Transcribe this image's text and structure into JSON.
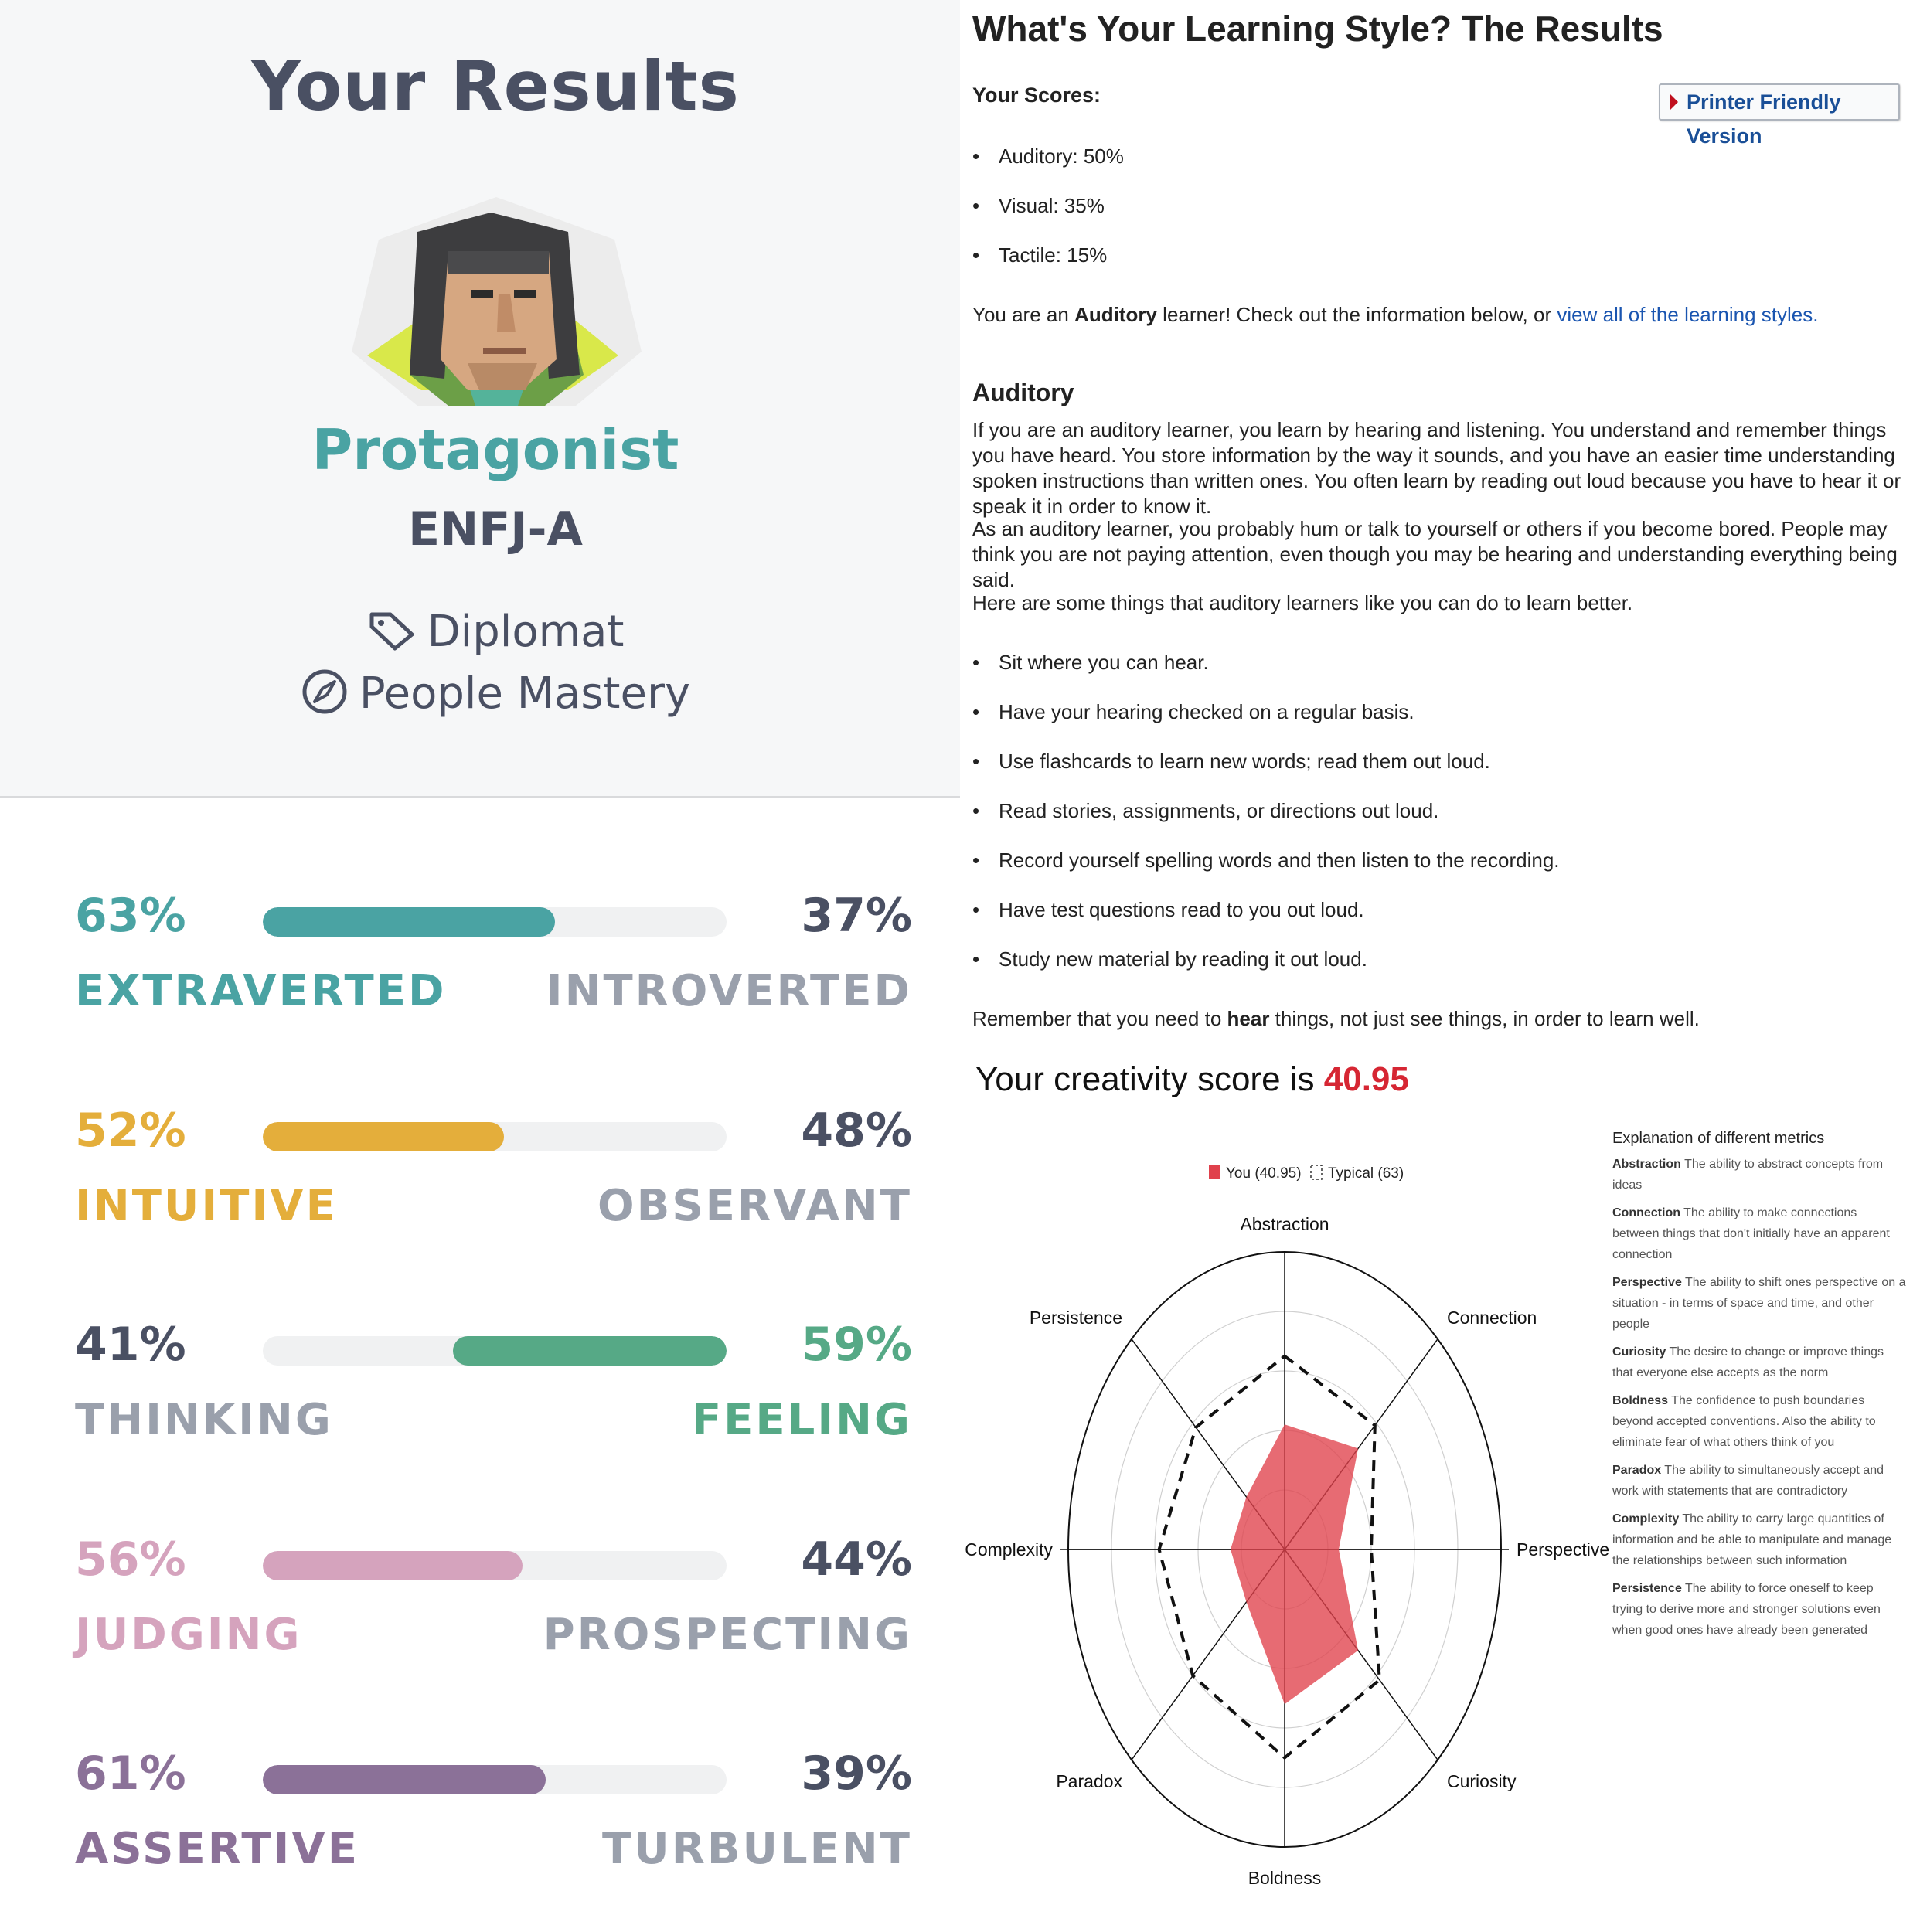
{
  "left": {
    "title": "Your Results",
    "type_name": "Protagonist",
    "type_code": "ENFJ-A",
    "role": "Diplomat",
    "strategy": "People Mastery",
    "traits": [
      {
        "left_pct": "63%",
        "right_pct": "37%",
        "left_label": "EXTRAVERTED",
        "right_label": "INTROVERTED",
        "fill_side": "left",
        "fill_fraction": 0.63,
        "color": "#4aa3a3"
      },
      {
        "left_pct": "52%",
        "right_pct": "48%",
        "left_label": "INTUITIVE",
        "right_label": "OBSERVANT",
        "fill_side": "left",
        "fill_fraction": 0.52,
        "color": "#e4ae3b"
      },
      {
        "left_pct": "41%",
        "right_pct": "59%",
        "left_label": "THINKING",
        "right_label": "FEELING",
        "fill_side": "right",
        "fill_fraction": 0.59,
        "color": "#56a986"
      },
      {
        "left_pct": "56%",
        "right_pct": "44%",
        "left_label": "JUDGING",
        "right_label": "PROSPECTING",
        "fill_side": "left",
        "fill_fraction": 0.56,
        "color": "#d5a3bd"
      },
      {
        "left_pct": "61%",
        "right_pct": "39%",
        "left_label": "ASSERTIVE",
        "right_label": "TURBULENT",
        "fill_side": "left",
        "fill_fraction": 0.61,
        "color": "#8b7198"
      }
    ]
  },
  "learning": {
    "title": "What's Your Learning Style? The Results",
    "scores_label": "Your Scores:",
    "printer_button": "Printer Friendly Version",
    "scores": [
      "Auditory: 50%",
      "Visual: 35%",
      "Tactile: 15%"
    ],
    "summary_pre": "You are an ",
    "summary_bold": "Auditory",
    "summary_mid": " learner! Check out the information below, or ",
    "summary_link": "view all of the learning styles.",
    "section_heading": "Auditory",
    "para1": "If you are an auditory learner, you learn by hearing and listening. You understand and remember things you have heard. You store information by the way it sounds, and you have an easier time understanding spoken instructions than written ones. You often learn by reading out loud because you have to hear it or speak it in order to know it.",
    "para2": "As an auditory learner, you probably hum or talk to yourself or others if you become bored. People may think you are not paying attention, even though you may be hearing and understanding everything being said.",
    "para3": "Here are some things that auditory learners like you can do to learn better.",
    "tips": [
      "Sit where you can hear.",
      "Have your hearing checked on a regular basis.",
      "Use flashcards to learn new words; read them out loud.",
      "Read stories, assignments, or directions out loud.",
      "Record yourself spelling words and then listen to the recording.",
      "Have test questions read to you out loud.",
      "Study new material by reading it out loud."
    ],
    "remember_pre": "Remember that you need to ",
    "remember_bold": "hear",
    "remember_post": " things, not just see things, in order to learn well."
  },
  "creativity": {
    "title_pre": "Your creativity score is ",
    "score": "40.95",
    "legend_you": "You (40.95)",
    "legend_typical": "Typical (63)",
    "explain_heading": "Explanation of different metrics",
    "metrics": [
      {
        "name": "Abstraction",
        "desc": "The ability to abstract concepts from ideas"
      },
      {
        "name": "Connection",
        "desc": "The ability to make connections between things that don't initially have an apparent connection"
      },
      {
        "name": "Perspective",
        "desc": "The ability to shift ones perspective on a situation - in terms of space and time, and other people"
      },
      {
        "name": "Curiosity",
        "desc": "The desire to change or improve things that everyone else accepts as the norm"
      },
      {
        "name": "Boldness",
        "desc": "The confidence to push boundaries beyond accepted conventions. Also the ability to eliminate fear of what others think of you"
      },
      {
        "name": "Paradox",
        "desc": "The ability to simultaneously accept and work with statements that are contradictory"
      },
      {
        "name": "Complexity",
        "desc": "The ability to carry large quantities of information and be able to manipulate and manage the relationships between such information"
      },
      {
        "name": "Persistence",
        "desc": "The ability to force oneself to keep trying to derive more and stronger solutions even when good ones have already been generated"
      }
    ]
  },
  "chart_data": {
    "type": "radar",
    "categories": [
      "Abstraction",
      "Connection",
      "Perspective",
      "Curiosity",
      "Boldness",
      "Paradox",
      "Complexity",
      "Persistence"
    ],
    "series": [
      {
        "name": "You (40.95)",
        "values": [
          42,
          48,
          25,
          48,
          52,
          25,
          25,
          25
        ],
        "color": "#e0414c"
      },
      {
        "name": "Typical (63)",
        "values": [
          65,
          59,
          40,
          62,
          70,
          60,
          58,
          58
        ],
        "color": "#111111"
      }
    ],
    "range": [
      0,
      100
    ],
    "rings": 5,
    "legend": "top"
  }
}
